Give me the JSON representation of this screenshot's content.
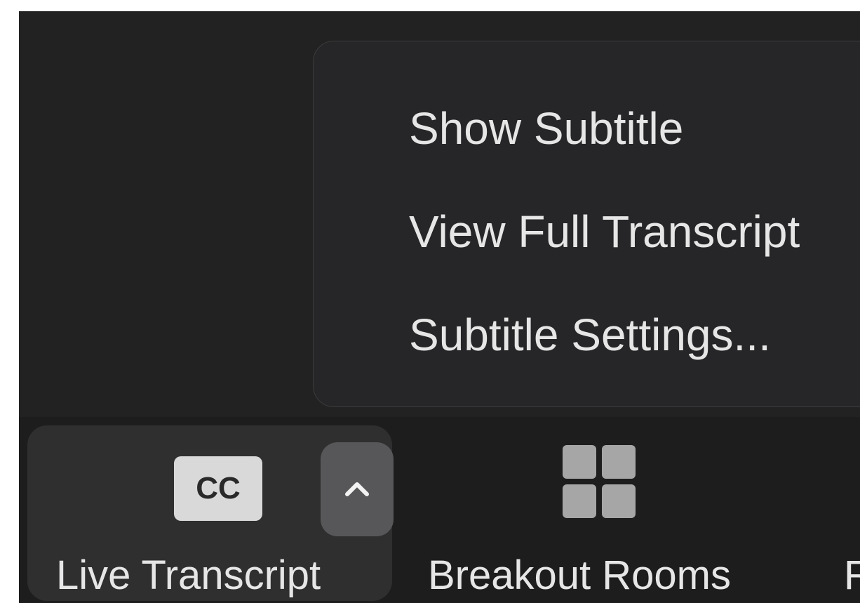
{
  "menu": {
    "items": [
      {
        "label": "Show Subtitle"
      },
      {
        "label": "View Full Transcript"
      },
      {
        "label": "Subtitle Settings..."
      }
    ]
  },
  "toolbar": {
    "live_transcript": {
      "icon_text": "CC",
      "label": "Live Transcript"
    },
    "breakout_rooms": {
      "label": "Breakout Rooms"
    },
    "partial_next": {
      "label": "R"
    }
  },
  "icons": {
    "cc": "cc-icon",
    "chevron": "chevron-up-icon",
    "breakout": "breakout-rooms-icon"
  },
  "colors": {
    "window_bg": "#222222",
    "menu_bg": "#262628",
    "toolbar_bg": "#1d1d1d",
    "text": "#e6e6e6",
    "icon_gray": "#a6a6a6"
  }
}
